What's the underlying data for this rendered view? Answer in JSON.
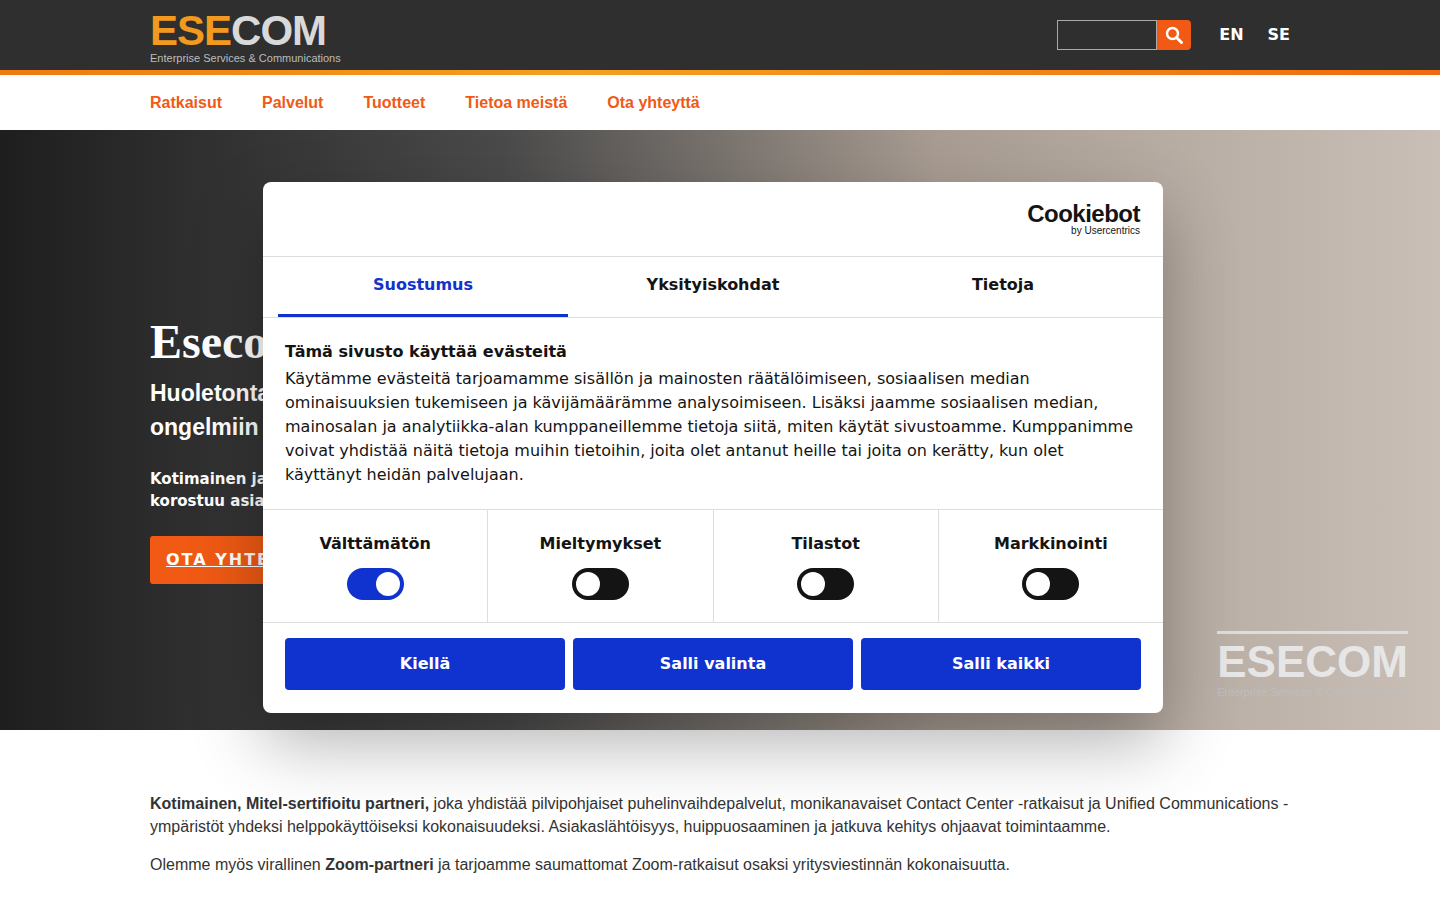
{
  "header": {
    "logo": {
      "parts": [
        {
          "text": "ESE",
          "color": "#f29a1f"
        },
        {
          "text": "COM",
          "color": "#d9d9d9"
        }
      ],
      "tagline": "Enterprise Services & Communications"
    },
    "languages": [
      "EN",
      "SE"
    ]
  },
  "nav": [
    "Ratkaisut",
    "Palvelut",
    "Tuotteet",
    "Tietoa meistä",
    "Ota yhteyttä"
  ],
  "hero": {
    "title": "Esecom",
    "subtitle_lines": [
      "Huoletonta j",
      "ongelmiin va"
    ],
    "text_lines": [
      "Kotimainen ja l",
      "korostuu asiak"
    ],
    "button": "OTA YHTEY",
    "watermark": {
      "title": "ESECOM",
      "tagline": "Enterprise Services & Communications"
    }
  },
  "cookie_dialog": {
    "brand": "Cookiebot",
    "brand_sub": "by Usercentrics",
    "tabs": [
      {
        "label": "Suostumus",
        "selected": true
      },
      {
        "label": "Yksityiskohdat",
        "selected": false
      },
      {
        "label": "Tietoja",
        "selected": false
      }
    ],
    "heading": "Tämä sivusto käyttää evästeitä",
    "body": "Käytämme evästeitä tarjoamamme sisällön ja mainosten räätälöimiseen, sosiaalisen median ominaisuuksien tukemiseen ja kävijämäärämme analysoimiseen. Lisäksi jaamme sosiaalisen median, mainosalan ja analytiikka-alan kumppaneillemme tietoja siitä, miten käytät sivustoamme. Kumppanimme voivat yhdistää näitä tietoja muihin tietoihin, joita olet antanut heille tai joita on kerätty, kun olet käyttänyt heidän palvelujaan.",
    "categories": [
      {
        "label": "Välttämätön",
        "on": true
      },
      {
        "label": "Mieltymykset",
        "on": false
      },
      {
        "label": "Tilastot",
        "on": false
      },
      {
        "label": "Markkinointi",
        "on": false
      }
    ],
    "buttons": [
      "Kiellä",
      "Salli valinta",
      "Salli kaikki"
    ]
  },
  "intro": [
    [
      {
        "text": "Kotimainen, Mitel-sertifioitu partneri,",
        "bold": true
      },
      {
        "text": " joka yhdistää pilvipohjaiset puhelinvaihdepalvelut, monikanavaiset Contact Center -ratkaisut ja Unified Communications -ympäristöt yhdeksi helppokäyttöiseksi kokonaisuudeksi. Asiakaslähtöisyys, huippuosaaminen ja jatkuva kehitys ohjaavat toimintaamme.",
        "bold": false
      }
    ],
    [
      {
        "text": "Olemme myös virallinen ",
        "bold": false
      },
      {
        "text": "Zoom-partneri",
        "bold": true
      },
      {
        "text": " ja tarjoamme saumattomat Zoom-ratkaisut osaksi yritysviestinnän kokonaisuutta.",
        "bold": false
      }
    ]
  ]
}
